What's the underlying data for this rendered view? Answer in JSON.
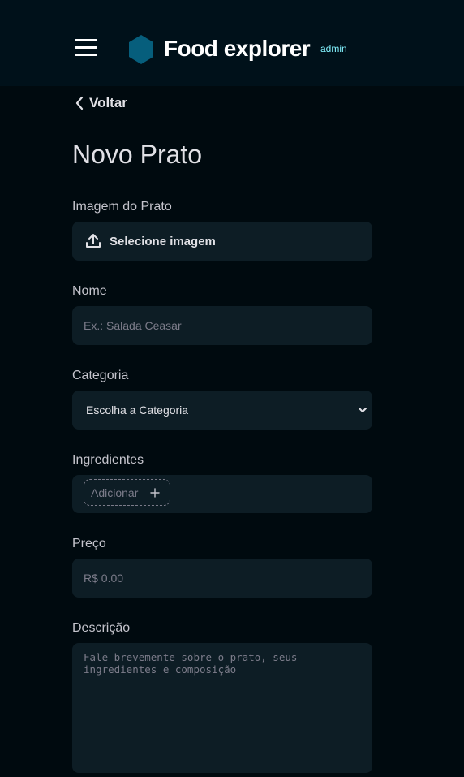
{
  "colors": {
    "background": "#000a0f",
    "header": "#00111a",
    "input_bg": "#0d1d25",
    "accent": "#065e7c",
    "admin_badge": "#82f3ff",
    "placeholder": "#7c7c8a"
  },
  "header": {
    "menu_icon": "hamburger-menu-icon",
    "logo_icon": "hexagon-logo-icon",
    "brand": "Food explorer",
    "badge": "admin"
  },
  "nav": {
    "back_label": "Voltar",
    "back_icon": "chevron-left-icon"
  },
  "page": {
    "title": "Novo Prato"
  },
  "form": {
    "image": {
      "label": "Imagem do Prato",
      "button_label": "Selecione imagem",
      "icon": "upload-icon"
    },
    "name": {
      "label": "Nome",
      "placeholder": "Ex.: Salada Ceasar",
      "value": ""
    },
    "category": {
      "label": "Categoria",
      "selected": "Escolha a Categoria",
      "icon": "chevron-down-icon"
    },
    "ingredients": {
      "label": "Ingredientes",
      "add_label": "Adicionar",
      "add_icon": "plus-icon"
    },
    "price": {
      "label": "Preço",
      "placeholder": "R$ 0.00",
      "value": ""
    },
    "description": {
      "label": "Descrição",
      "placeholder": "Fale brevemente sobre o prato, seus ingredientes e composição",
      "value": ""
    }
  }
}
